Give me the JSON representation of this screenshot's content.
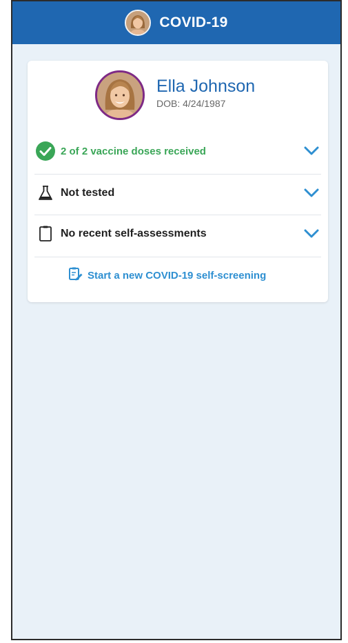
{
  "header": {
    "title": "COVID-19",
    "avatar_icon": "profile-photo"
  },
  "profile": {
    "name": "Ella Johnson",
    "dob": "DOB: 4/24/1987"
  },
  "status_rows": [
    {
      "label": "2 of 2 vaccine doses received",
      "icon": "check-circle-icon",
      "status_color": "#3aa657"
    },
    {
      "label": "Not tested",
      "icon": "flask-icon"
    },
    {
      "label": "No recent self-assessments",
      "icon": "clipboard-icon"
    }
  ],
  "screening_link": {
    "label": "Start a new COVID-19 self-screening",
    "icon": "clipboard-edit-icon"
  },
  "colors": {
    "header_bg": "#1f67b1",
    "page_bg": "#e9f1f8",
    "accent_blue": "#2e8fd1",
    "avatar_ring": "#7e2a86",
    "success_green": "#3aa657"
  }
}
